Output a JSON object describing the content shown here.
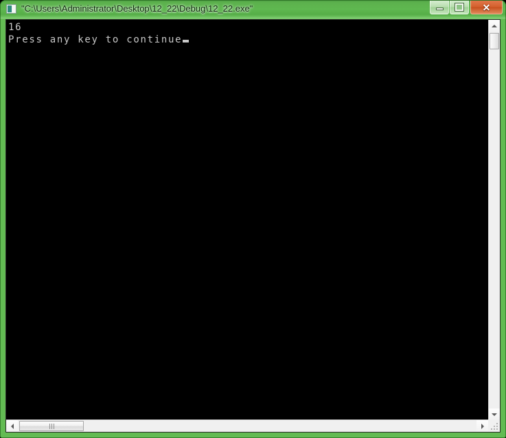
{
  "window": {
    "title": "\"C:\\Users\\Administrator\\Desktop\\12_22\\Debug\\12_22.exe\"",
    "icon_name": "console-window-icon",
    "frame_color": "#63bb53",
    "titlebar_gradient_top": "#4e9f45",
    "titlebar_gradient_bottom": "#8ed382"
  },
  "caption_buttons": {
    "minimize": {
      "label": "–",
      "name": "minimize-button"
    },
    "maximize": {
      "label": "□",
      "name": "maximize-button"
    },
    "close": {
      "label": "✕",
      "name": "close-button",
      "color": "#d5622f"
    }
  },
  "console": {
    "background_color": "#000000",
    "text_color": "#c8c8c8",
    "lines": [
      "16",
      "Press any key to continue"
    ],
    "cursor_visible": true
  },
  "scrollbars": {
    "vertical": {
      "up_arrow": "▲",
      "down_arrow": "▼",
      "thumb_position_percent": 0,
      "track_color": "#f0f0f0"
    },
    "horizontal": {
      "left_arrow": "◀",
      "right_arrow": "▶",
      "thumb_position_percent": 0,
      "track_color": "#f0f0f0"
    },
    "size_grip": "resize-grip"
  }
}
